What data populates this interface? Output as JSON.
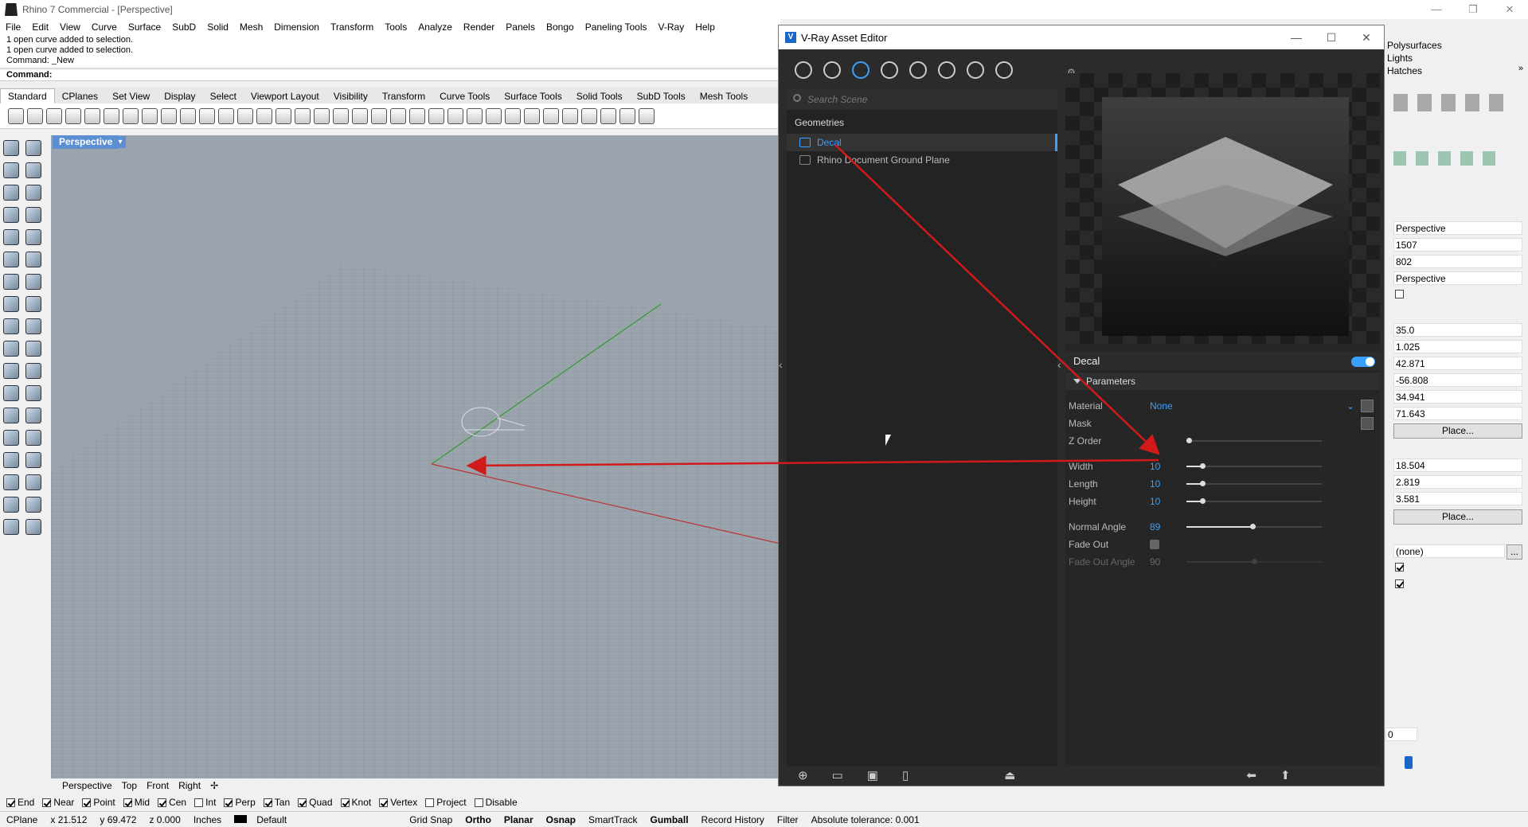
{
  "app": {
    "title": "Rhino 7 Commercial - [Perspective]",
    "win_min": "—",
    "win_max": "❐",
    "win_close": "✕"
  },
  "menu": [
    "File",
    "Edit",
    "View",
    "Curve",
    "Surface",
    "SubD",
    "Solid",
    "Mesh",
    "Dimension",
    "Transform",
    "Tools",
    "Analyze",
    "Render",
    "Panels",
    "Bongo",
    "Paneling Tools",
    "V-Ray",
    "Help"
  ],
  "command": {
    "history": [
      "1 open curve added to selection.",
      "1 open curve added to selection.",
      "Command: _New"
    ],
    "prompt": "Command:"
  },
  "toolbar_tabs": [
    "Standard",
    "CPlanes",
    "Set View",
    "Display",
    "Select",
    "Viewport Layout",
    "Visibility",
    "Transform",
    "Curve Tools",
    "Surface Tools",
    "Solid Tools",
    "SubD Tools",
    "Mesh Tools"
  ],
  "viewport": {
    "label": "Perspective",
    "tabs": [
      "Perspective",
      "Top",
      "Front",
      "Right"
    ]
  },
  "osnap": [
    {
      "label": "End",
      "on": true
    },
    {
      "label": "Near",
      "on": true
    },
    {
      "label": "Point",
      "on": true
    },
    {
      "label": "Mid",
      "on": true
    },
    {
      "label": "Cen",
      "on": true
    },
    {
      "label": "Int",
      "on": false
    },
    {
      "label": "Perp",
      "on": true
    },
    {
      "label": "Tan",
      "on": true
    },
    {
      "label": "Quad",
      "on": true
    },
    {
      "label": "Knot",
      "on": true
    },
    {
      "label": "Vertex",
      "on": true
    },
    {
      "label": "Project",
      "on": false
    },
    {
      "label": "Disable",
      "on": false
    }
  ],
  "status": {
    "cplane": "CPlane",
    "x": "x 21.512",
    "y": "y 69.472",
    "z": "z 0.000",
    "units": "Inches",
    "layer": "Default",
    "grid_snap": "Grid Snap",
    "ortho": "Ortho",
    "planar": "Planar",
    "osnap": "Osnap",
    "smarttrack": "SmartTrack",
    "gumball": "Gumball",
    "record_history": "Record History",
    "filter": "Filter",
    "tolerance": "Absolute tolerance: 0.001"
  },
  "right_panel": {
    "checks": [
      "Polysurfaces",
      "Lights",
      "Hatches"
    ],
    "fields1": [
      "Perspective",
      "1507",
      "802",
      "Perspective"
    ],
    "fields2": [
      "35.0",
      "1.025",
      "42.871",
      "-56.808",
      "34.941",
      "71.643"
    ],
    "place": "Place...",
    "fields3": [
      "18.504",
      "2.819",
      "3.581"
    ],
    "none_field": "(none)",
    "ellipsis": "...",
    "spin_value": "0"
  },
  "vray": {
    "title": "V-Ray Asset Editor",
    "search_placeholder": "Search Scene",
    "section": "Geometries",
    "items": [
      "Decal",
      "Rhino Document Ground Plane"
    ],
    "decal_label": "Decal",
    "params_label": "Parameters",
    "params": {
      "material": {
        "label": "Material",
        "value": "None"
      },
      "mask": {
        "label": "Mask"
      },
      "zorder": {
        "label": "Z Order",
        "value": "1",
        "level": 0.02
      },
      "width": {
        "label": "Width",
        "value": "10",
        "level": 0.12
      },
      "length": {
        "label": "Length",
        "value": "10",
        "level": 0.12
      },
      "height": {
        "label": "Height",
        "value": "10",
        "level": 0.12
      },
      "normal_angle": {
        "label": "Normal Angle",
        "value": "89",
        "level": 0.49
      },
      "fade_out": {
        "label": "Fade Out"
      },
      "fade_out_angle": {
        "label": "Fade Out Angle",
        "value": "90",
        "level": 0.5
      }
    }
  },
  "colors": {
    "accent": "#3aa0ff",
    "annotation": "#d21a1a",
    "viewport_bg": "#9ba4ad"
  }
}
